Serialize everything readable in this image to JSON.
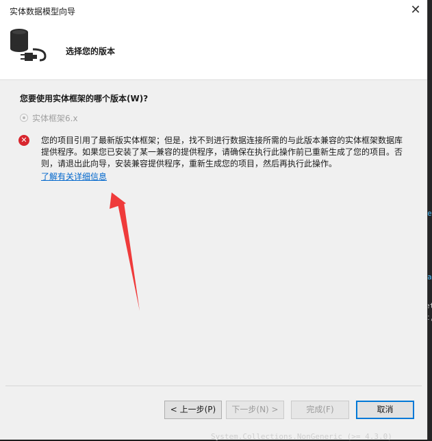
{
  "dialog": {
    "title": "实体数据模型向导",
    "close_glyph": "✕"
  },
  "header": {
    "title": "选择您的版本",
    "icon": "database-plug-icon"
  },
  "question": "您要使用实体框架的哪个版本(W)?",
  "radio": {
    "label": "实体框架6.x",
    "selected": true,
    "enabled": false
  },
  "error": {
    "icon": "error-icon",
    "glyph": "✕",
    "lines": [
      "您的项目引用了最新版实体框架；但是，找不到进行数据连接所需的与此版本兼容的实体框架数据库",
      "提供程序。如果您已安装了某一兼容的提供程序，请确保在执行此操作前已重新生成了您的项目。否",
      "则，请退出此向导，安装兼容提供程序，重新生成您的项目，然后再执行此操作。"
    ],
    "link": "了解有关详细信息"
  },
  "buttons": {
    "back": "< 上一步(P)",
    "next": "下一步(N) >",
    "finish": "完成(F)",
    "cancel": "取消"
  },
  "background": {
    "frag1": "e",
    "frag2": "a",
    "frag3": "et",
    "frag4": "t,",
    "frag5": "System.Collections.NonGeneric (>= 4.3.0)"
  },
  "colors": {
    "error_red": "#d8262e",
    "link_blue": "#0066cc",
    "arrow_red": "#ef3b3b",
    "accent_blue": "#0078d7"
  }
}
